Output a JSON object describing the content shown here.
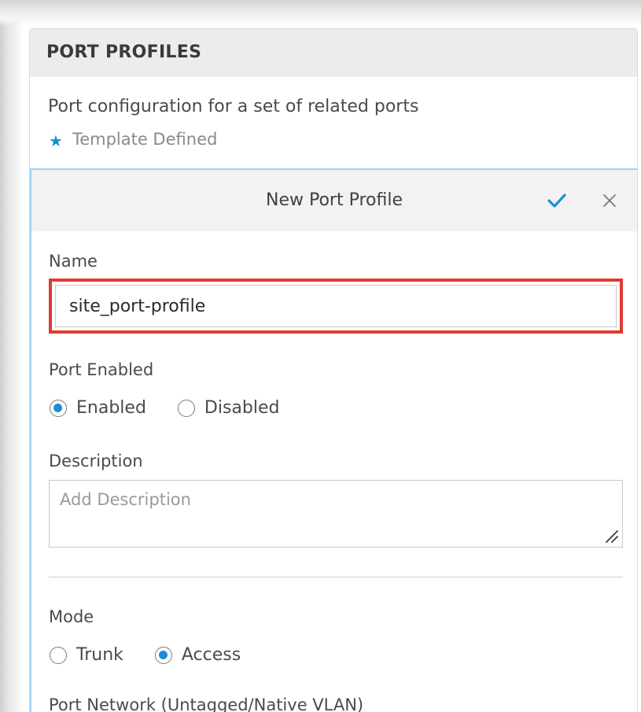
{
  "panel": {
    "title": "PORT PROFILES",
    "description": "Port configuration for a set of related ports",
    "template_defined": "Template Defined"
  },
  "form": {
    "title": "New Port Profile",
    "name_label": "Name",
    "name_value": "site_port-profile",
    "port_enabled_label": "Port Enabled",
    "port_enabled_options": [
      "Enabled",
      "Disabled"
    ],
    "port_enabled_selected": "Enabled",
    "description_label": "Description",
    "description_placeholder": "Add Description",
    "mode_label": "Mode",
    "mode_options": [
      "Trunk",
      "Access"
    ],
    "mode_selected": "Access",
    "port_network_label": "Port Network (Untagged/Native VLAN)"
  },
  "colors": {
    "accent": "#1a8fd6",
    "highlight_box": "#e03a32"
  },
  "icons": {
    "star": "star-icon",
    "confirm": "check-icon",
    "close": "close-icon",
    "resize": "resize-handle-icon"
  }
}
